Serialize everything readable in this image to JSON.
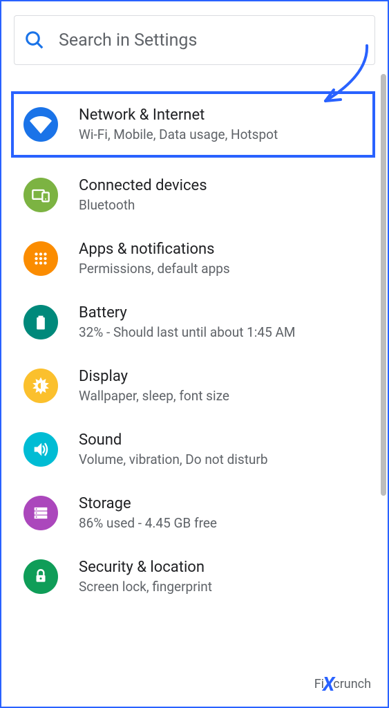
{
  "search": {
    "placeholder": "Search in Settings"
  },
  "items": [
    {
      "title": "Network & Internet",
      "subtitle": "Wi-Fi, Mobile, Data usage, Hotspot",
      "icon_name": "wifi-icon",
      "icon_color": "#1a73e8",
      "highlighted": true
    },
    {
      "title": "Connected devices",
      "subtitle": "Bluetooth",
      "icon_name": "devices-icon",
      "icon_color": "#7cb342"
    },
    {
      "title": "Apps & notifications",
      "subtitle": "Permissions, default apps",
      "icon_name": "apps-icon",
      "icon_color": "#fb8c00"
    },
    {
      "title": "Battery",
      "subtitle": "32% - Should last until about 1:45 AM",
      "icon_name": "battery-icon",
      "icon_color": "#00897b"
    },
    {
      "title": "Display",
      "subtitle": "Wallpaper, sleep, font size",
      "icon_name": "display-icon",
      "icon_color": "#fbc02d"
    },
    {
      "title": "Sound",
      "subtitle": "Volume, vibration, Do not disturb",
      "icon_name": "sound-icon",
      "icon_color": "#00bcd4"
    },
    {
      "title": "Storage",
      "subtitle": "86% used - 4.45 GB free",
      "icon_name": "storage-icon",
      "icon_color": "#ab47bc"
    },
    {
      "title": "Security & location",
      "subtitle": "Screen lock, fingerprint",
      "icon_name": "security-icon",
      "icon_color": "#0f9d58"
    }
  ],
  "watermark": {
    "fi": "Fi",
    "x": "X",
    "crunch": "crunch"
  }
}
